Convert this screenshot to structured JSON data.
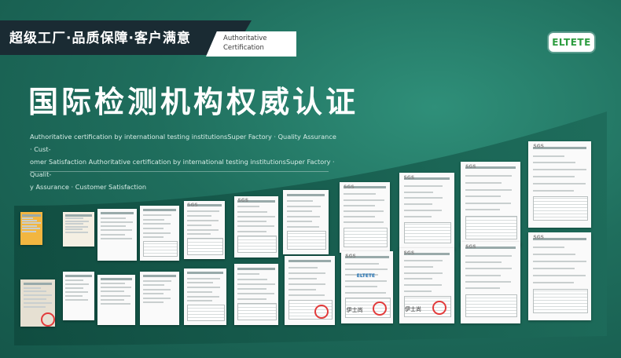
{
  "banner": {
    "text": "超级工厂·品质保障·客户满意"
  },
  "badge": {
    "line1": "Authoritative",
    "line2": "Certification"
  },
  "logo": {
    "text": "ELTETE"
  },
  "headline": {
    "title": "国际检测机构权威认证"
  },
  "description": {
    "line1": "Authoritative certification by international testing institutionsSuper Factory · Quality Assurance · Cust-",
    "line2": "omer Satisfaction  Authoritative certification by international testing institutionsSuper Factory · Qualit-",
    "line3": "y Assurance · Customer Satisfaction"
  },
  "colors": {
    "bg_dark": "#15574a",
    "bg_light": "#2f8f79",
    "banner": "#1a2b33",
    "logo_green": "#2c9c3f",
    "seal_red": "#e23b3b"
  },
  "certificates": {
    "doc_label": "SGS",
    "seal_label": "ELTETE",
    "sig_text": "伊士尚"
  }
}
